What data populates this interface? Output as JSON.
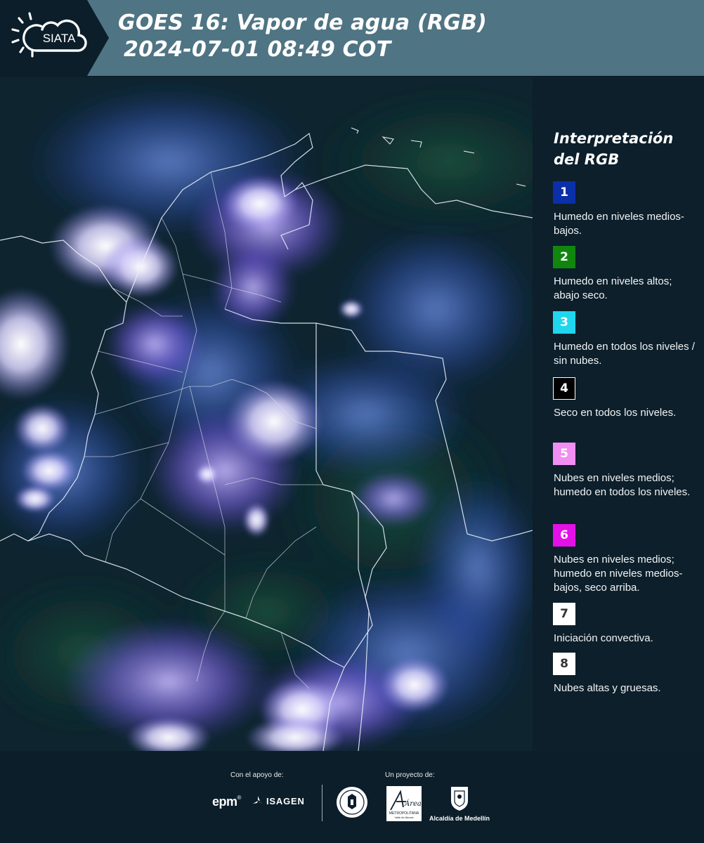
{
  "header": {
    "logo_text": "SIATA",
    "title_line1": "GOES 16: Vapor de agua (RGB)",
    "title_line2": "2024-07-01 08:49 COT"
  },
  "legend": {
    "title_line1": "Interpretación",
    "title_line2": "del RGB",
    "items": [
      {
        "num": "1",
        "color": "#0b2fa8",
        "text": "Humedo en niveles medios-bajos."
      },
      {
        "num": "2",
        "color": "#11860f",
        "text": "Humedo en niveles altos; abajo seco."
      },
      {
        "num": "3",
        "color": "#1fd6ee",
        "text": "Humedo en todos los niveles / sin nubes."
      },
      {
        "num": "4",
        "color": "#000000",
        "text": "Seco en todos los niveles."
      },
      {
        "num": "5",
        "color": "#f08ef2",
        "text": "Nubes en niveles medios; humedo en todos los niveles."
      },
      {
        "num": "6",
        "color": "#e410e8",
        "text": "Nubes en niveles medios; humedo en niveles medios-bajos, seco arriba."
      },
      {
        "num": "7",
        "color": "#ffffff",
        "text": "Iniciación convectiva."
      },
      {
        "num": "8",
        "color": "#ffffff",
        "text": "Nubes altas y gruesas."
      }
    ]
  },
  "footer": {
    "support_label": "Con el apoyo de:",
    "project_label": "Un proyecto de:",
    "epm": "epm",
    "isagen": "ISAGEN",
    "metropolitana": "METROPOLITANA",
    "area_script": "Área",
    "valle": "Valle de Aburrá",
    "alcaldia": "Alcaldía de Medellín"
  },
  "colors": {
    "header_bg": "#4f7483",
    "logo_bg": "#0b1e2a",
    "page_bg": "#0b1e2a"
  }
}
